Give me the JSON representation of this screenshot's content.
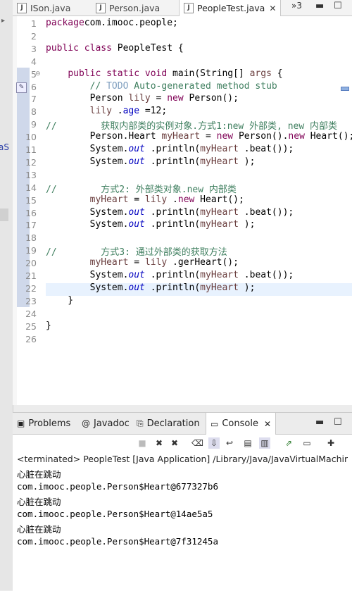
{
  "editor_tabs": [
    {
      "label": "ISon.java"
    },
    {
      "label": "Person.java"
    },
    {
      "label": "PeopleTest.java",
      "active": true
    }
  ],
  "overflow_label": "»3",
  "line_numbers": [
    "1",
    "2",
    "3",
    "4",
    "5",
    "6",
    "7",
    "8",
    "9",
    "10",
    "11",
    "12",
    "13",
    "14",
    "15",
    "16",
    "17",
    "18",
    "19",
    "20",
    "21",
    "22",
    "23",
    "24",
    "25",
    "26"
  ],
  "code_tokens": [
    [
      [
        "kw",
        "package"
      ],
      [
        "",
        "com.imooc.people;"
      ]
    ],
    [],
    [
      [
        "kw",
        "public class"
      ],
      [
        "",
        " PeopleTest {"
      ]
    ],
    [],
    [
      [
        "",
        "    "
      ],
      [
        "kw",
        "public static void"
      ],
      [
        "",
        " main(String[] "
      ],
      [
        "var",
        "args"
      ],
      [
        "",
        " {"
      ]
    ],
    [
      [
        "",
        "        "
      ],
      [
        "cm",
        "// "
      ],
      [
        "todo",
        "TODO"
      ],
      [
        "cm",
        " Auto-generated method stub"
      ]
    ],
    [
      [
        "",
        "        Person "
      ],
      [
        "var",
        "lily"
      ],
      [
        "",
        " = "
      ],
      [
        "kw",
        "new"
      ],
      [
        "",
        " Person();"
      ]
    ],
    [
      [
        "",
        "        "
      ],
      [
        "var",
        "lily"
      ],
      [
        "",
        " ."
      ],
      [
        "fld",
        "age"
      ],
      [
        "",
        " =12;"
      ]
    ],
    [
      [
        "cm",
        "//        获取内部类的实例对象.方式1:new 外部类, new 内部类"
      ]
    ],
    [
      [
        "",
        "        Person.Heart "
      ],
      [
        "var",
        "myHeart"
      ],
      [
        "",
        " = "
      ],
      [
        "kw",
        "new"
      ],
      [
        "",
        " Person()."
      ],
      [
        "kw",
        "new"
      ],
      [
        "",
        " Heart();"
      ]
    ],
    [
      [
        "",
        "        System."
      ],
      [
        "st",
        "out"
      ],
      [
        "",
        " .println("
      ],
      [
        "var",
        "myHeart"
      ],
      [
        "",
        " .beat());"
      ]
    ],
    [
      [
        "",
        "        System."
      ],
      [
        "st",
        "out"
      ],
      [
        "",
        " .println("
      ],
      [
        "var",
        "myHeart"
      ],
      [
        "",
        " );"
      ]
    ],
    [],
    [
      [
        "cm",
        "//        方式2: 外部类对象.new 内部类"
      ]
    ],
    [
      [
        "",
        "        "
      ],
      [
        "var",
        "myHeart"
      ],
      [
        "",
        " = "
      ],
      [
        "var",
        "lily"
      ],
      [
        "",
        " ."
      ],
      [
        "kw",
        "new"
      ],
      [
        "",
        " Heart();"
      ]
    ],
    [
      [
        "",
        "        System."
      ],
      [
        "st",
        "out"
      ],
      [
        "",
        " .println("
      ],
      [
        "var",
        "myHeart"
      ],
      [
        "",
        " .beat());"
      ]
    ],
    [
      [
        "",
        "        System."
      ],
      [
        "st",
        "out"
      ],
      [
        "",
        " .println("
      ],
      [
        "var",
        "myHeart"
      ],
      [
        "",
        " );"
      ]
    ],
    [],
    [
      [
        "cm",
        "//        方式3: 通过外部类的获取方法"
      ]
    ],
    [
      [
        "",
        "        "
      ],
      [
        "var",
        "myHeart"
      ],
      [
        "",
        " = "
      ],
      [
        "var",
        "lily"
      ],
      [
        "",
        " .gerHeart();"
      ]
    ],
    [
      [
        "",
        "        System."
      ],
      [
        "st",
        "out"
      ],
      [
        "",
        " .println("
      ],
      [
        "var",
        "myHeart"
      ],
      [
        "",
        " .beat());"
      ]
    ],
    [
      [
        "",
        "        System."
      ],
      [
        "st",
        "out"
      ],
      [
        "",
        " .println("
      ],
      [
        "var",
        "myHeart"
      ],
      [
        "",
        " );"
      ]
    ],
    [
      [
        "",
        "    }"
      ]
    ],
    [],
    [
      [
        "",
        "}"
      ]
    ],
    []
  ],
  "panel_tabs": [
    {
      "label": "Problems",
      "icon": "problems-icon",
      "glyph": "▣"
    },
    {
      "label": "Javadoc",
      "icon": "javadoc-icon",
      "glyph": "@"
    },
    {
      "label": "Declaration",
      "icon": "declaration-icon",
      "glyph": "⎘"
    },
    {
      "label": "Console",
      "icon": "console-icon",
      "glyph": "▭",
      "active": true
    }
  ],
  "console": {
    "status": "<terminated> PeopleTest [Java Application] /Library/Java/JavaVirtualMachines/jc",
    "lines": [
      "心脏在跳动",
      "com.imooc.people.Person$Heart@677327b6",
      "心脏在跳动",
      "com.imooc.people.Person$Heart@14ae5a5",
      "心脏在跳动",
      "com.imooc.people.Person$Heart@7f31245a"
    ]
  },
  "left_strip_text": "aS",
  "colors": {
    "keyword": "#7f0055",
    "comment": "#3f7f5f",
    "variable": "#6a3e3e",
    "field": "#0000c0",
    "current_line": "#e8f2fe"
  }
}
